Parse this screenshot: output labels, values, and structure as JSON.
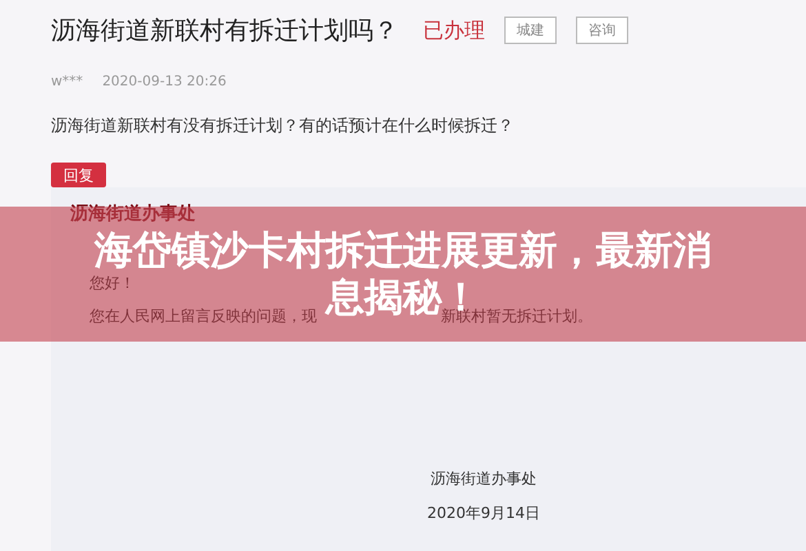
{
  "question": {
    "title": "沥海街道新联村有拆迁计划吗？",
    "status": "已办理",
    "tags": [
      "城建",
      "咨询"
    ],
    "author": "w***",
    "time": "2020-09-13 20:26",
    "body": "沥海街道新联村有没有拆迁计划？有的话预计在什么时候拆迁？"
  },
  "reply_button": "回复",
  "reply": {
    "org": "沥海街道办事处",
    "greeting": "您好！",
    "body_parts": [
      "您在人民网上留言反映的问题，现",
      "新联村暂无拆迁计划。"
    ],
    "signature": "沥海街道办事处",
    "date": "2020年9月14日"
  },
  "banner": {
    "headline": "海岱镇沙卡村拆迁进展更新，最新消息揭秘！"
  }
}
